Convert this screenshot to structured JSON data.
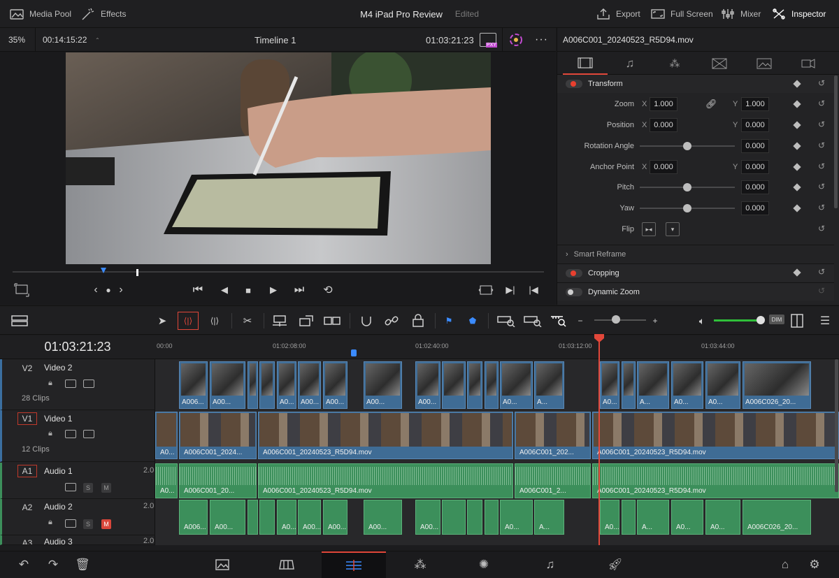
{
  "topbar": {
    "media_pool": "Media Pool",
    "effects": "Effects",
    "project_name": "M4 iPad Pro Review",
    "project_status": "Edited",
    "export": "Export",
    "full_screen": "Full Screen",
    "mixer": "Mixer",
    "inspector": "Inspector"
  },
  "viewer": {
    "zoom": "35%",
    "duration": "00:14:15:22",
    "timeline_name": "Timeline 1",
    "timecode": "01:03:21:23",
    "proxy_badge": "PXY"
  },
  "inspector": {
    "clip_name": "A006C001_20240523_R5D94.mov",
    "transform_title": "Transform",
    "zoom_label": "Zoom",
    "zoom_x": "1.000",
    "zoom_y": "1.000",
    "position_label": "Position",
    "position_x": "0.000",
    "position_y": "0.000",
    "rotation_label": "Rotation Angle",
    "rotation_value": "0.000",
    "anchor_label": "Anchor Point",
    "anchor_x": "0.000",
    "anchor_y": "0.000",
    "pitch_label": "Pitch",
    "pitch_value": "0.000",
    "yaw_label": "Yaw",
    "yaw_value": "0.000",
    "flip_label": "Flip",
    "x_axis": "X",
    "y_axis": "Y",
    "smart_reframe": "Smart Reframe",
    "cropping": "Cropping",
    "dynamic_zoom": "Dynamic Zoom"
  },
  "timeline": {
    "timecode": "01:03:21:23",
    "ruler": [
      "00:00",
      "01:02:08:00",
      "01:02:40:00",
      "01:03:12:00",
      "01:03:44:00"
    ],
    "tracks": {
      "v2": {
        "id": "V2",
        "name": "Video 2",
        "count": "28 Clips"
      },
      "v1": {
        "id": "V1",
        "name": "Video 1",
        "count": "12 Clips"
      },
      "a1": {
        "id": "A1",
        "name": "Audio 1",
        "channels": "2.0",
        "solo": "S",
        "mute": "M"
      },
      "a2": {
        "id": "A2",
        "name": "Audio 2",
        "channels": "2.0",
        "solo": "S",
        "mute": "M"
      },
      "a3": {
        "id": "A3",
        "name": "Audio 3",
        "channels": "2.0"
      }
    },
    "v2_clips": [
      "A006...",
      "A00...",
      "",
      "A0...",
      "A00...",
      "A00...",
      "A00...",
      "A00...",
      "A0...",
      "A...",
      "A0...",
      "",
      "A...",
      "A0...",
      "A0...",
      "A006C026_20..."
    ],
    "v1_clips": [
      "A0...",
      "A006C001_2024...",
      "A006C001_20240523_R5D94.mov",
      "A006C001_202...",
      "A006C001_20240523_R5D94.mov"
    ],
    "a1_clips": [
      "A0...",
      "A006C001_20...",
      "A006C001_20240523_R5D94.mov",
      "A006C001_2...",
      "A006C001_20240523_R5D94.mov"
    ],
    "a2_clips": [
      "A006...",
      "A00...",
      "",
      "A0...",
      "A00...",
      "A00...",
      "A00...",
      "A00...",
      "A0...",
      "A...",
      "A0...",
      "",
      "A...",
      "A0...",
      "A0...",
      "A006C026_20..."
    ]
  },
  "toolbar": {
    "dim": "DIM"
  },
  "colors": {
    "accent_red": "#e2473a",
    "video_clip": "#3f6c95",
    "audio_clip": "#3c8f5b",
    "volume_green": "#2fbf3a"
  }
}
